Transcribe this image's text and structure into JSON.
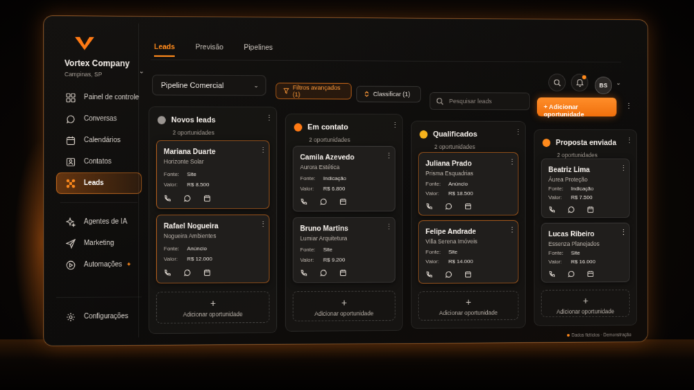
{
  "brand": {
    "company": "Vortex Company",
    "city": "Campinas, SP"
  },
  "sidebar": {
    "items": [
      {
        "label": "Painel de controle",
        "icon": "grid-icon"
      },
      {
        "label": "Conversas",
        "icon": "chat-icon"
      },
      {
        "label": "Calendários",
        "icon": "calendar-icon"
      },
      {
        "label": "Contatos",
        "icon": "contact-card-icon"
      },
      {
        "label": "Leads",
        "icon": "leads-network-icon",
        "active": true
      }
    ],
    "items2": [
      {
        "label": "Agentes de IA",
        "icon": "sparkles-icon"
      },
      {
        "label": "Marketing",
        "icon": "send-icon"
      },
      {
        "label": "Automações",
        "icon": "play-circle-icon"
      }
    ],
    "settings": "Configurações"
  },
  "tabs": [
    {
      "label": "Leads",
      "active": true
    },
    {
      "label": "Previsão"
    },
    {
      "label": "Pipelines"
    }
  ],
  "toolbar": {
    "pipeline": "Pipeline Comercial",
    "filters": "Filtros avançados (1)",
    "sort": "Classificar (1)",
    "search_placeholder": "Pesquisar leads",
    "add_button": "Adicionar oportunidade",
    "avatar": "BS"
  },
  "columns": [
    {
      "title": "Novos leads",
      "count": "2 oportunidades",
      "dot_color": "#9a9591",
      "cards": [
        {
          "name": "Mariana Duarte",
          "company": "Horizonte Solar",
          "source_label": "Fonte:",
          "source": "Site",
          "value_label": "Valor:",
          "value": "R$ 8.500"
        },
        {
          "name": "Rafael Nogueira",
          "company": "Nogueira Ambientes",
          "source_label": "Fonte:",
          "source": "Anúncio",
          "value_label": "Valor:",
          "value": "R$ 12.000"
        }
      ]
    },
    {
      "title": "Em contato",
      "count": "2 oportunidades",
      "dot_color": "#ff7a14",
      "cards": [
        {
          "name": "Camila Azevedo",
          "company": "Aurora Estética",
          "source_label": "Fonte:",
          "source": "Indicação",
          "value_label": "Valor:",
          "value": "R$ 6.800"
        },
        {
          "name": "Bruno Martins",
          "company": "Lumiar Arquitetura",
          "source_label": "Fonte:",
          "source": "Site",
          "value_label": "Valor:",
          "value": "R$ 9.200"
        }
      ]
    },
    {
      "title": "Qualificados",
      "count": "2 oportunidades",
      "dot_color": "#f5b21c",
      "cards": [
        {
          "name": "Juliana Prado",
          "company": "Prisma Esquadrias",
          "source_label": "Fonte:",
          "source": "Anúncio",
          "value_label": "Valor:",
          "value": "R$ 18.500"
        },
        {
          "name": "Felipe Andrade",
          "company": "Villa Serena Imóveis",
          "source_label": "Fonte:",
          "source": "Site",
          "value_label": "Valor:",
          "value": "R$ 14.000"
        }
      ]
    },
    {
      "title": "Proposta enviada",
      "count": "2 oportunidades",
      "dot_color": "#ff8a1c",
      "cards": [
        {
          "name": "Beatriz Lima",
          "company": "Áurea Proteção",
          "source_label": "Fonte:",
          "source": "Indicação",
          "value_label": "Valor:",
          "value": "R$ 7.500"
        },
        {
          "name": "Lucas Ribeiro",
          "company": "Essenza Planejados",
          "source_label": "Fonte:",
          "source": "Site",
          "value_label": "Valor:",
          "value": "R$ 16.000"
        }
      ]
    }
  ],
  "add_slot_label": "Adicionar oportunidade",
  "footer": "Dados fictícios · Demonstração",
  "colors": {
    "accent": "#ff8a1c",
    "panel": "#181614",
    "card": "#201e1c"
  }
}
